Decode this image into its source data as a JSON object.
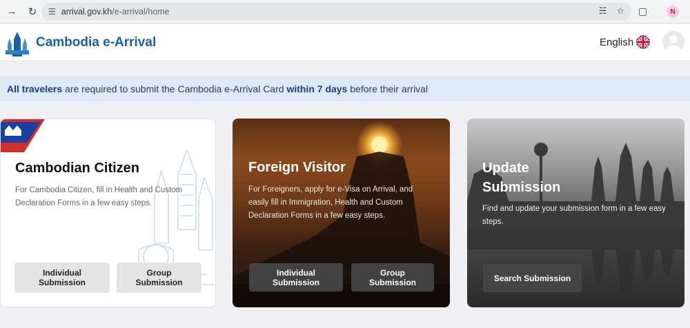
{
  "browser": {
    "url_host": "arrival.gov.kh",
    "url_path": "/e-arrival/home",
    "profile_initial": "N",
    "icons": [
      "back-arrow-icon",
      "reload-icon",
      "site-settings-icon",
      "translate-icon",
      "bookmark-star-icon",
      "extensions-icon"
    ]
  },
  "header": {
    "title": "Cambodia e-Arrival",
    "language": "English"
  },
  "banner": {
    "part1": "All travelers",
    "part2": " are required to submit the Cambodia e-Arrival Card ",
    "part3": "within 7 days",
    "part4": " before their arrival"
  },
  "cards": {
    "citizen": {
      "title": "Cambodian Citizen",
      "description": "For Cambodia Citizen, fill in Health and Custom Declaration Forms in a few easy steps.",
      "button1": "Individual Submission",
      "button2": "Group Submission"
    },
    "visitor": {
      "title": "Foreign Visitor",
      "description": "For Foreigners, apply for e-Visa on Arrival, and easily fill in Immigration, Health and Custom Declaration Forms in a few easy steps.",
      "button1": "Individual Submission",
      "button2": "Group Submission"
    },
    "update": {
      "title": "Update Submission",
      "description": "Find and update your submission form in a few easy steps.",
      "button1": "Search Submission"
    }
  },
  "colors": {
    "brand": "#1a5fa6",
    "banner_bg": "#dde9f7"
  }
}
